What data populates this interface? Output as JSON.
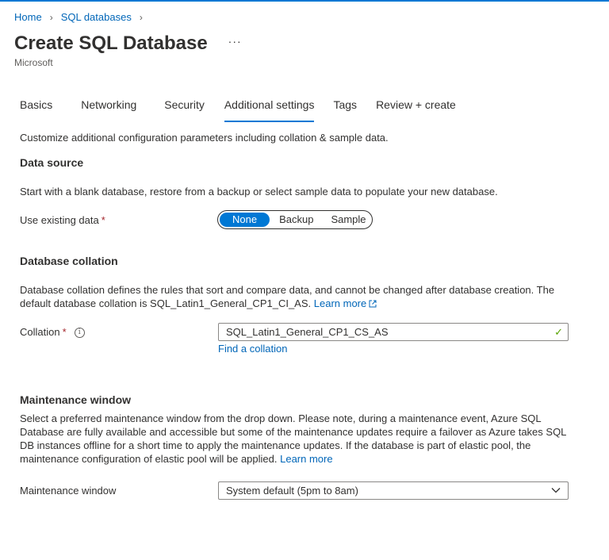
{
  "breadcrumb": {
    "items": [
      "Home",
      "SQL databases"
    ]
  },
  "header": {
    "title": "Create SQL Database",
    "more_label": "···",
    "subtitle": "Microsoft"
  },
  "tabs": [
    {
      "label": "Basics",
      "active": false
    },
    {
      "label": "Networking",
      "active": false
    },
    {
      "label": "Security",
      "active": false
    },
    {
      "label": "Additional settings",
      "active": true
    },
    {
      "label": "Tags",
      "active": false
    },
    {
      "label": "Review + create",
      "active": false
    }
  ],
  "intro": "Customize additional configuration parameters including collation & sample data.",
  "data_source": {
    "heading": "Data source",
    "description": "Start with a blank database, restore from a backup or select sample data to populate your new database.",
    "label": "Use existing data",
    "required_mark": "*",
    "options": [
      "None",
      "Backup",
      "Sample"
    ],
    "selected": "None"
  },
  "collation": {
    "heading": "Database collation",
    "description_line1": "Database collation defines the rules that sort and compare data, and cannot be changed after database creation. The",
    "description_line2": "default database collation is SQL_Latin1_General_CP1_CI_AS.",
    "learn_more": "Learn more",
    "label": "Collation",
    "required_mark": "*",
    "value": "SQL_Latin1_General_CP1_CS_AS",
    "find_link": "Find a collation"
  },
  "maintenance": {
    "heading": "Maintenance window",
    "description_line1": "Select a preferred maintenance window from the drop down. Please note, during a maintenance event, Azure SQL",
    "description_line2": "Database are fully available and accessible but some of the maintenance updates require a failover as Azure takes SQL",
    "description_line3": "DB instances offline for a short time to apply the maintenance updates. If the database is part of elastic pool, the",
    "description_line4": "maintenance configuration of elastic pool will be applied.",
    "learn_more": "Learn more",
    "label": "Maintenance window",
    "value": "System default (5pm to 8am)"
  },
  "colors": {
    "accent": "#0078d4",
    "link": "#0066b8",
    "valid_check": "#57a300",
    "required": "#a4262c"
  }
}
